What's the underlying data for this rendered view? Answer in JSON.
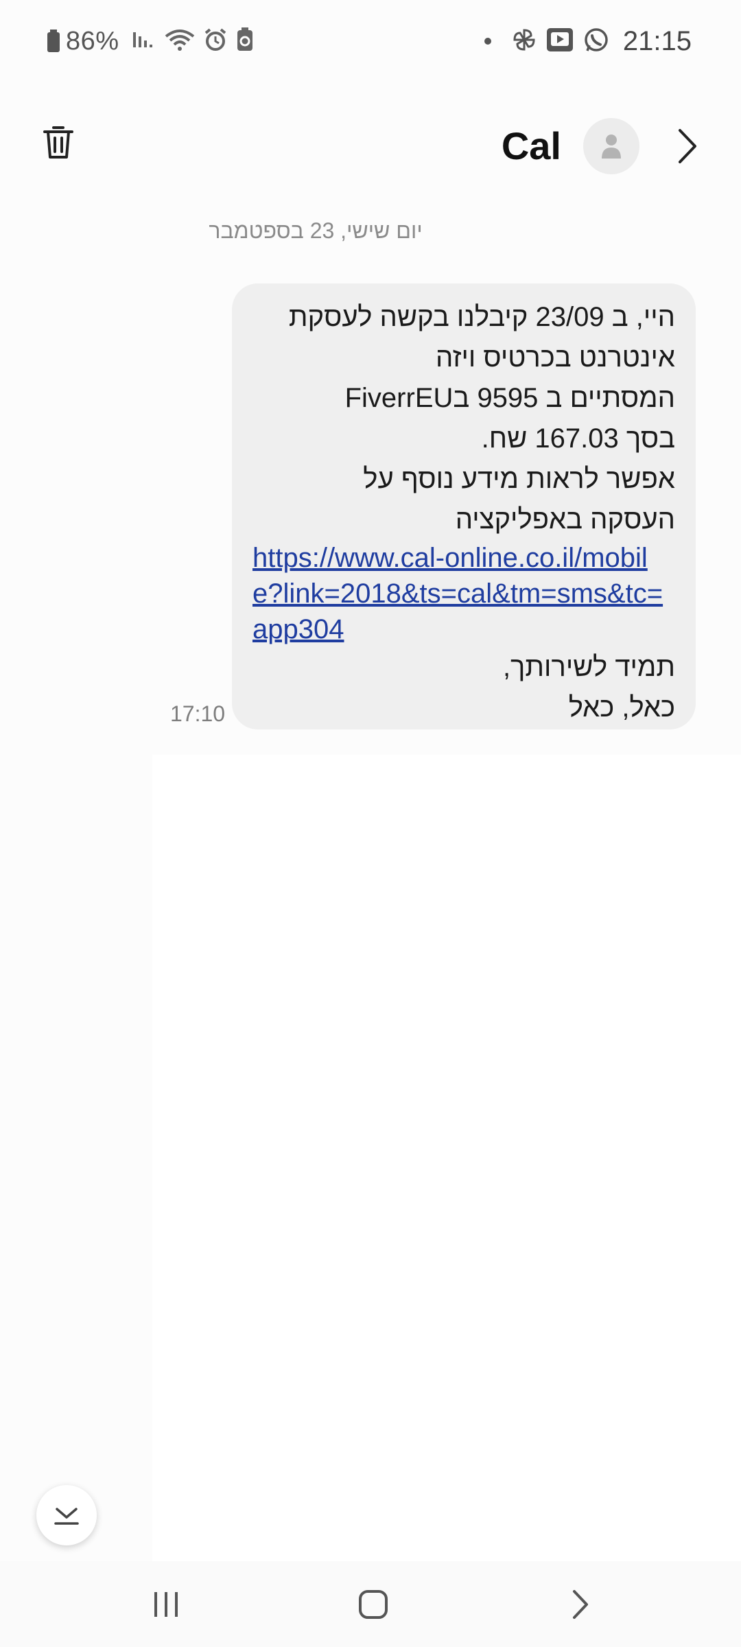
{
  "status_bar": {
    "battery": "86%",
    "time": "21:15",
    "left_icons": [
      "battery-icon",
      "signal-icon",
      "wifi-icon",
      "alarm-icon",
      "battery-saver-icon"
    ],
    "right_icons": [
      "notification-dot-icon",
      "pinwheel-icon",
      "youtube-icon",
      "whatsapp-icon"
    ]
  },
  "header": {
    "contact_name": "Cal"
  },
  "conversation": {
    "date_separator": "יום שישי, 23 בספטמבר",
    "message": {
      "lines_before_link": [
        "היי, ב 23/09 קיבלנו בקשה לעסקת",
        "אינטרנט בכרטיס ויזה",
        "המסתיים ב 9595 בFiverrEU",
        "בסך 167.03 שח.",
        "אפשר לראות מידע נוסף על",
        "העסקה באפליקציה"
      ],
      "link": "https://www.cal-online.co.il/mobile?link=2018&ts=cal&tm=sms&tc=app304",
      "lines_after_link": [
        "תמיד לשירותך,",
        "כאל, כאל"
      ],
      "time": "17:10",
      "colors": {
        "bubble": "#efefef",
        "link": "#1f3da0"
      }
    }
  }
}
